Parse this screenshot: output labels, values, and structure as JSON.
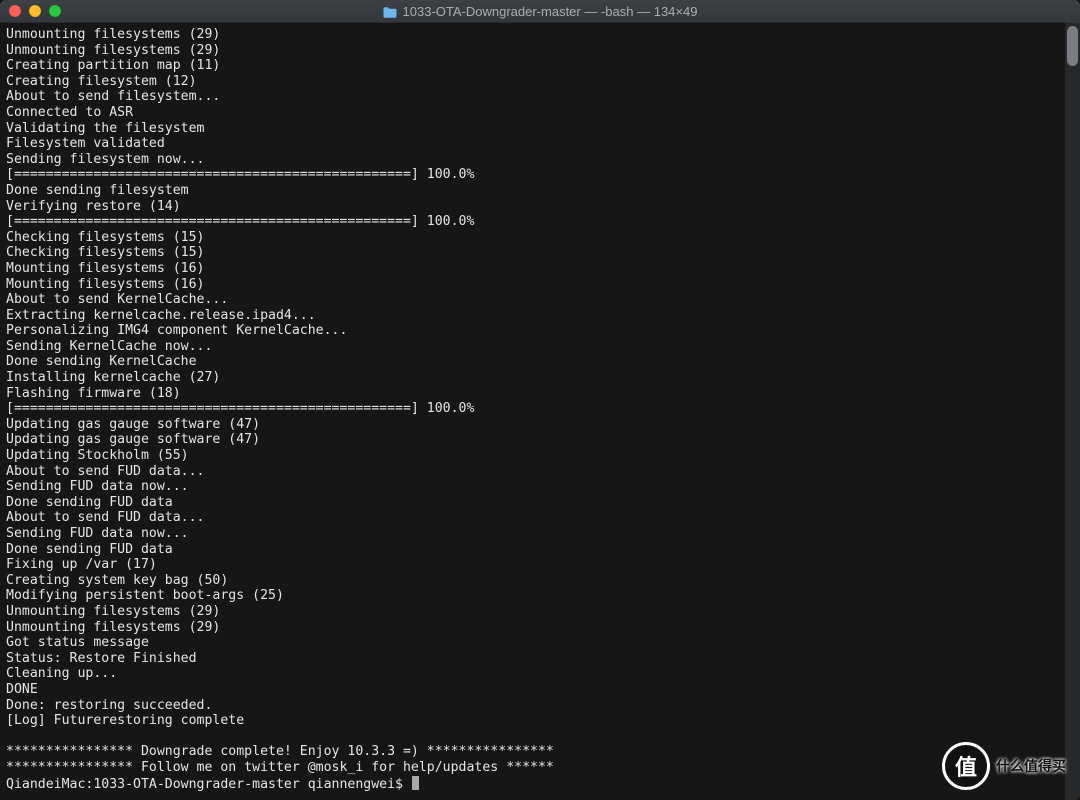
{
  "titlebar": {
    "title": "1033-OTA-Downgrader-master — -bash — 134×49",
    "folder_icon": "folder-icon"
  },
  "terminal": {
    "lines": [
      "Unmounting filesystems (29)",
      "Unmounting filesystems (29)",
      "Creating partition map (11)",
      "Creating filesystem (12)",
      "About to send filesystem...",
      "Connected to ASR",
      "Validating the filesystem",
      "Filesystem validated",
      "Sending filesystem now...",
      "[==================================================] 100.0%",
      "Done sending filesystem",
      "Verifying restore (14)",
      "[==================================================] 100.0%",
      "Checking filesystems (15)",
      "Checking filesystems (15)",
      "Mounting filesystems (16)",
      "Mounting filesystems (16)",
      "About to send KernelCache...",
      "Extracting kernelcache.release.ipad4...",
      "Personalizing IMG4 component KernelCache...",
      "Sending KernelCache now...",
      "Done sending KernelCache",
      "Installing kernelcache (27)",
      "Flashing firmware (18)",
      "[==================================================] 100.0%",
      "Updating gas gauge software (47)",
      "Updating gas gauge software (47)",
      "Updating Stockholm (55)",
      "About to send FUD data...",
      "Sending FUD data now...",
      "Done sending FUD data",
      "About to send FUD data...",
      "Sending FUD data now...",
      "Done sending FUD data",
      "Fixing up /var (17)",
      "Creating system key bag (50)",
      "Modifying persistent boot-args (25)",
      "Unmounting filesystems (29)",
      "Unmounting filesystems (29)",
      "Got status message",
      "Status: Restore Finished",
      "Cleaning up...",
      "DONE",
      "Done: restoring succeeded.",
      "[Log] Futurerestoring complete",
      "",
      "**************** Downgrade complete! Enjoy 10.3.3 =) ****************",
      "**************** Follow me on twitter @mosk_i for help/updates ******"
    ],
    "prompt": "QiandeiMac:1033-OTA-Downgrader-master qiannengwei$ "
  },
  "watermark": {
    "badge": "值",
    "text": "什么值得买"
  }
}
